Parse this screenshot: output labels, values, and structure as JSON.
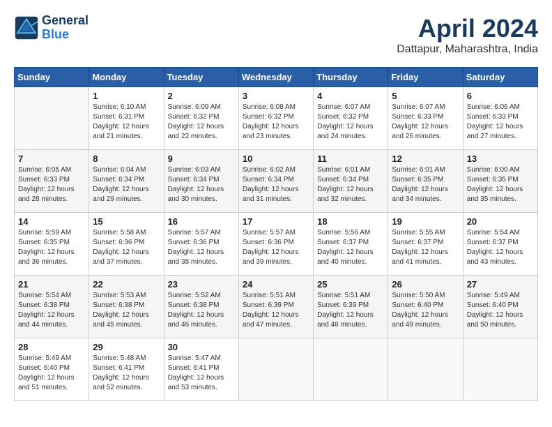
{
  "header": {
    "logo_line1": "General",
    "logo_line2": "Blue",
    "month": "April 2024",
    "location": "Dattapur, Maharashtra, India"
  },
  "weekdays": [
    "Sunday",
    "Monday",
    "Tuesday",
    "Wednesday",
    "Thursday",
    "Friday",
    "Saturday"
  ],
  "weeks": [
    [
      {
        "day": "",
        "info": ""
      },
      {
        "day": "1",
        "info": "Sunrise: 6:10 AM\nSunset: 6:31 PM\nDaylight: 12 hours\nand 21 minutes."
      },
      {
        "day": "2",
        "info": "Sunrise: 6:09 AM\nSunset: 6:32 PM\nDaylight: 12 hours\nand 22 minutes."
      },
      {
        "day": "3",
        "info": "Sunrise: 6:08 AM\nSunset: 6:32 PM\nDaylight: 12 hours\nand 23 minutes."
      },
      {
        "day": "4",
        "info": "Sunrise: 6:07 AM\nSunset: 6:32 PM\nDaylight: 12 hours\nand 24 minutes."
      },
      {
        "day": "5",
        "info": "Sunrise: 6:07 AM\nSunset: 6:33 PM\nDaylight: 12 hours\nand 26 minutes."
      },
      {
        "day": "6",
        "info": "Sunrise: 6:06 AM\nSunset: 6:33 PM\nDaylight: 12 hours\nand 27 minutes."
      }
    ],
    [
      {
        "day": "7",
        "info": "Sunrise: 6:05 AM\nSunset: 6:33 PM\nDaylight: 12 hours\nand 28 minutes."
      },
      {
        "day": "8",
        "info": "Sunrise: 6:04 AM\nSunset: 6:34 PM\nDaylight: 12 hours\nand 29 minutes."
      },
      {
        "day": "9",
        "info": "Sunrise: 6:03 AM\nSunset: 6:34 PM\nDaylight: 12 hours\nand 30 minutes."
      },
      {
        "day": "10",
        "info": "Sunrise: 6:02 AM\nSunset: 6:34 PM\nDaylight: 12 hours\nand 31 minutes."
      },
      {
        "day": "11",
        "info": "Sunrise: 6:01 AM\nSunset: 6:34 PM\nDaylight: 12 hours\nand 32 minutes."
      },
      {
        "day": "12",
        "info": "Sunrise: 6:01 AM\nSunset: 6:35 PM\nDaylight: 12 hours\nand 34 minutes."
      },
      {
        "day": "13",
        "info": "Sunrise: 6:00 AM\nSunset: 6:35 PM\nDaylight: 12 hours\nand 35 minutes."
      }
    ],
    [
      {
        "day": "14",
        "info": "Sunrise: 5:59 AM\nSunset: 6:35 PM\nDaylight: 12 hours\nand 36 minutes."
      },
      {
        "day": "15",
        "info": "Sunrise: 5:58 AM\nSunset: 6:36 PM\nDaylight: 12 hours\nand 37 minutes."
      },
      {
        "day": "16",
        "info": "Sunrise: 5:57 AM\nSunset: 6:36 PM\nDaylight: 12 hours\nand 38 minutes."
      },
      {
        "day": "17",
        "info": "Sunrise: 5:57 AM\nSunset: 6:36 PM\nDaylight: 12 hours\nand 39 minutes."
      },
      {
        "day": "18",
        "info": "Sunrise: 5:56 AM\nSunset: 6:37 PM\nDaylight: 12 hours\nand 40 minutes."
      },
      {
        "day": "19",
        "info": "Sunrise: 5:55 AM\nSunset: 6:37 PM\nDaylight: 12 hours\nand 41 minutes."
      },
      {
        "day": "20",
        "info": "Sunrise: 5:54 AM\nSunset: 6:37 PM\nDaylight: 12 hours\nand 43 minutes."
      }
    ],
    [
      {
        "day": "21",
        "info": "Sunrise: 5:54 AM\nSunset: 6:38 PM\nDaylight: 12 hours\nand 44 minutes."
      },
      {
        "day": "22",
        "info": "Sunrise: 5:53 AM\nSunset: 6:38 PM\nDaylight: 12 hours\nand 45 minutes."
      },
      {
        "day": "23",
        "info": "Sunrise: 5:52 AM\nSunset: 6:38 PM\nDaylight: 12 hours\nand 46 minutes."
      },
      {
        "day": "24",
        "info": "Sunrise: 5:51 AM\nSunset: 6:39 PM\nDaylight: 12 hours\nand 47 minutes."
      },
      {
        "day": "25",
        "info": "Sunrise: 5:51 AM\nSunset: 6:39 PM\nDaylight: 12 hours\nand 48 minutes."
      },
      {
        "day": "26",
        "info": "Sunrise: 5:50 AM\nSunset: 6:40 PM\nDaylight: 12 hours\nand 49 minutes."
      },
      {
        "day": "27",
        "info": "Sunrise: 5:49 AM\nSunset: 6:40 PM\nDaylight: 12 hours\nand 50 minutes."
      }
    ],
    [
      {
        "day": "28",
        "info": "Sunrise: 5:49 AM\nSunset: 6:40 PM\nDaylight: 12 hours\nand 51 minutes."
      },
      {
        "day": "29",
        "info": "Sunrise: 5:48 AM\nSunset: 6:41 PM\nDaylight: 12 hours\nand 52 minutes."
      },
      {
        "day": "30",
        "info": "Sunrise: 5:47 AM\nSunset: 6:41 PM\nDaylight: 12 hours\nand 53 minutes."
      },
      {
        "day": "",
        "info": ""
      },
      {
        "day": "",
        "info": ""
      },
      {
        "day": "",
        "info": ""
      },
      {
        "day": "",
        "info": ""
      }
    ]
  ]
}
